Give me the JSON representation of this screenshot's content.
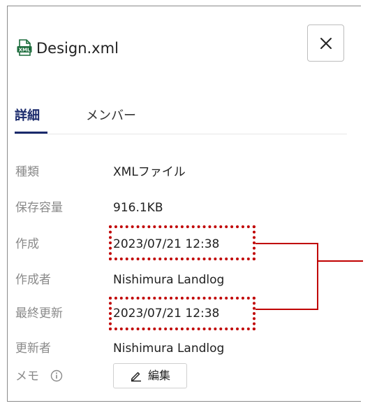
{
  "header": {
    "file_name": "Design.xml",
    "file_icon": "xml-file-icon",
    "close_icon": "close-icon"
  },
  "tabs": [
    {
      "label": "詳細",
      "active": true
    },
    {
      "label": "メンバー",
      "active": false
    }
  ],
  "details": [
    {
      "label": "種類",
      "value": "XMLファイル"
    },
    {
      "label": "保存容量",
      "value": "916.1KB"
    },
    {
      "label": "作成",
      "value": "2023/07/21 12:38"
    },
    {
      "label": "作成者",
      "value": "Nishimura Landlog"
    },
    {
      "label": "最終更新",
      "value": "2023/07/21 12:38"
    },
    {
      "label": "更新者",
      "value": "Nishimura Landlog"
    }
  ],
  "memo": {
    "label": "メモ",
    "info_icon": "info-icon",
    "edit_label": "編集",
    "edit_icon": "pencil-icon"
  },
  "colors": {
    "accent": "#1a2a6c",
    "highlight": "#c00000",
    "label_gray": "#8a8a8a"
  }
}
